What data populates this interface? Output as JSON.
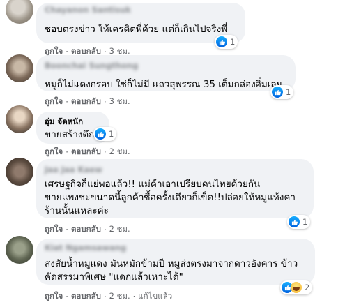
{
  "actions": {
    "like": "ถูกใจ",
    "reply": "ตอบกลับ",
    "dot": "·",
    "edited": "แก้ไขแล้ว"
  },
  "comments": [
    {
      "author": "Chayanon Santisuk",
      "text_lines": [
        "ชอบตรงข่าว ให้เครดิตพี่ด้วย แต่ก็เกินไปจริงพี่"
      ],
      "reaction_count": "1",
      "reaction_icons": [
        "like-icon"
      ],
      "time": "3 ชม."
    },
    {
      "author": "Boonchai Sungthong",
      "text_lines": [
        "หมูก็ไม่แดงกรอบ ใช่ก็ไม่มี แถวสุพรรณ 35 เต็มกล่องอิ่มเลย"
      ],
      "reaction_count": "1",
      "reaction_icons": [
        "like-icon"
      ],
      "time": "3 ชม."
    },
    {
      "author": "อุ่ม จัดหนัก",
      "text_lines": [
        "ขายสร้างตึก"
      ],
      "reaction_count": "1",
      "reaction_icons": [
        "like-icon"
      ],
      "time": "2 ชม."
    },
    {
      "author": "Jaa Jaa Kaew",
      "text_lines": [
        "เศรษฐกิจก็แย่พอแล้ว!! แม่ค้าเอาเปรียบคนไทยด้วยกัน",
        "ขายแพงชะขนาดนี้ลูกค้าซื้อครั้งเดียวก็เข็ด!!ปล่อยให้หมูแห้งคา",
        "ร้านนั้นแหละค่ะ"
      ],
      "reaction_count": "1",
      "reaction_icons": [
        "like-icon"
      ],
      "time": "2 ชม."
    },
    {
      "author": "Kiat Ngamsawang",
      "text_lines": [
        "สงสัยน้ำหมูแดง มันหมักข้ามปี หมูส่งตรงมาจากดาวอังคาร ข้าว",
        "คัดสรรมาพิเศษ \"แดกแล้วเหาะได้\""
      ],
      "reaction_count": "2",
      "reaction_icons": [
        "like-icon",
        "haha-icon"
      ],
      "time": "2 ชม."
    }
  ]
}
